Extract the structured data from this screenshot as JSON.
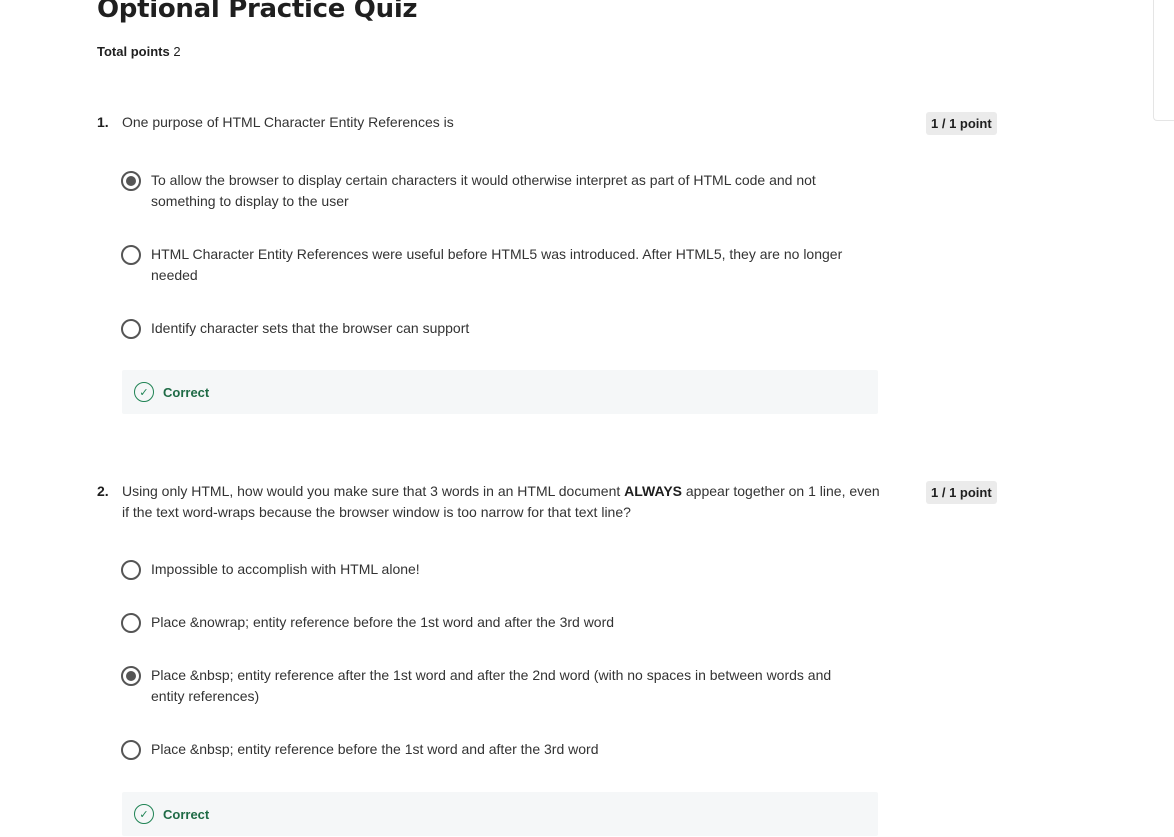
{
  "quiz": {
    "title": "Optional Practice Quiz",
    "total_points_label": "Total points",
    "total_points_value": "2"
  },
  "questions": [
    {
      "number": "1.",
      "text": "One purpose of HTML Character Entity References is",
      "points": "1 / 1 point",
      "options": [
        {
          "text": "To allow the browser to display certain characters it would otherwise interpret as part of HTML code and not something to display to the user",
          "selected": true
        },
        {
          "text": "HTML Character Entity References were useful before HTML5 was introduced. After HTML5, they are no longer needed",
          "selected": false
        },
        {
          "text": "Identify character sets that the browser can support",
          "selected": false
        }
      ],
      "feedback": "Correct"
    },
    {
      "number": "2.",
      "text_before": "Using only HTML, how would you make sure that 3 words in an HTML document ",
      "text_bold": "ALWAYS",
      "text_after": " appear together on 1 line, even if the text word-wraps because the browser window is too narrow for that text line?",
      "points": "1 / 1 point",
      "options": [
        {
          "text": "Impossible to accomplish with HTML alone!",
          "selected": false
        },
        {
          "text": "Place &nowrap; entity reference before the 1st word and after the 3rd word",
          "selected": false
        },
        {
          "text": "Place &nbsp; entity reference after the 1st word and after the 2nd word (with no spaces in between words and entity references)",
          "selected": true
        },
        {
          "text": "Place &nbsp; entity reference before the 1st word and after the 3rd word",
          "selected": false
        }
      ],
      "feedback": "Correct"
    }
  ],
  "icons": {
    "radio": "radio-icon",
    "feedback": "check-circle-icon"
  },
  "colors": {
    "correct_green": "#1f8354",
    "feedback_bg": "#f5f7f8",
    "badge_bg": "#ebebeb"
  }
}
